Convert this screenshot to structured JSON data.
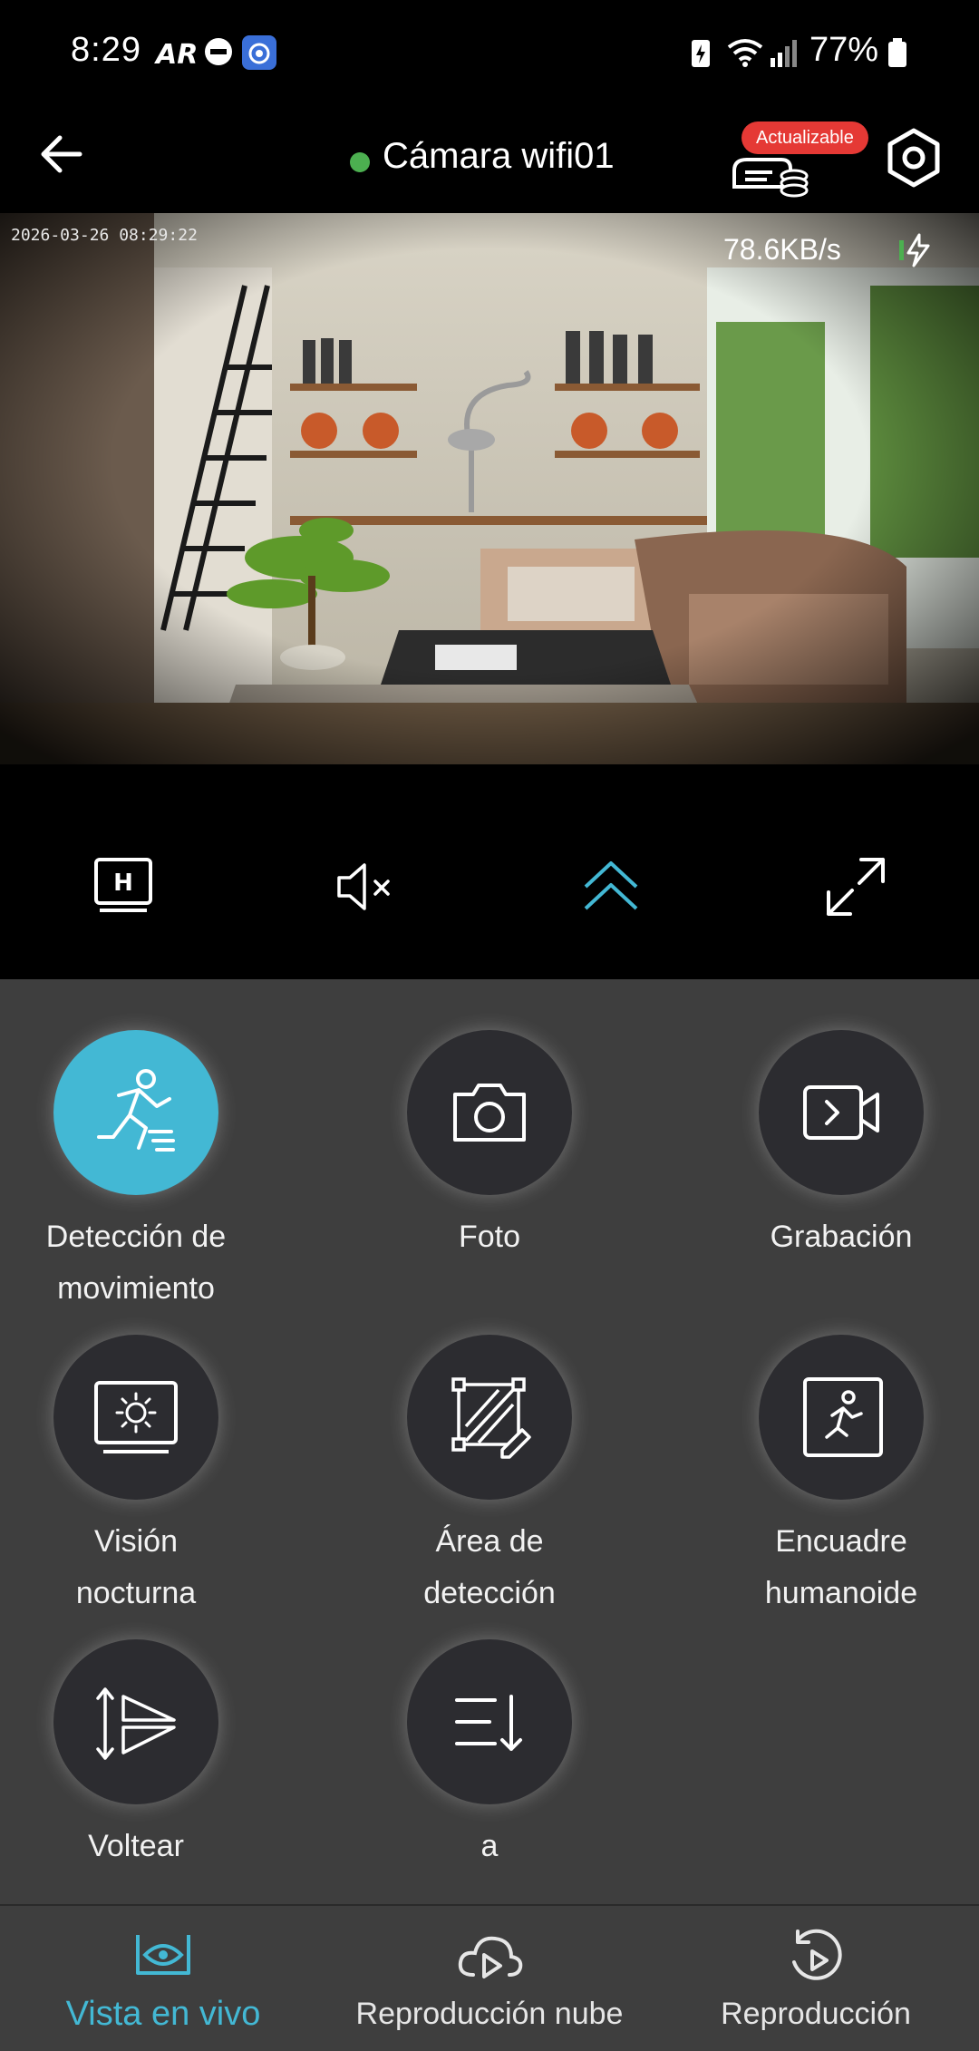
{
  "status_bar": {
    "time": "8:29",
    "battery": "77%"
  },
  "header": {
    "title": "Cámara wifi01",
    "update_badge": "Actualizable"
  },
  "video": {
    "timestamp": "2026-03-26 08:29:22",
    "bitrate": "78.6KB/s"
  },
  "controls": {
    "items": [
      "hd-quality-icon",
      "mute-icon",
      "collapse-up-icon",
      "fullscreen-icon"
    ]
  },
  "functions": [
    {
      "label_1": "Detección de",
      "label_2": "movimiento",
      "icon": "motion-detection-icon",
      "active": true
    },
    {
      "label_1": "Foto",
      "label_2": "",
      "icon": "camera-icon",
      "active": false
    },
    {
      "label_1": "Grabación",
      "label_2": "",
      "icon": "record-video-icon",
      "active": false
    },
    {
      "label_1": "Visión",
      "label_2": "nocturna",
      "icon": "night-vision-icon",
      "active": false
    },
    {
      "label_1": "Área de",
      "label_2": "detección",
      "icon": "detection-area-icon",
      "active": false
    },
    {
      "label_1": "Encuadre",
      "label_2": "humanoide",
      "icon": "humanoid-frame-icon",
      "active": false
    },
    {
      "label_1": "Voltear",
      "label_2": "",
      "icon": "flip-icon",
      "active": false
    },
    {
      "label_1": "a",
      "label_2": "",
      "icon": "sort-icon",
      "active": false
    }
  ],
  "bottom_nav": {
    "items": [
      {
        "label": "Vista en vivo",
        "icon": "live-view-eye-icon",
        "active": true
      },
      {
        "label": "Reproducción nube",
        "icon": "cloud-playback-icon",
        "active": false
      },
      {
        "label": "Reproducción",
        "icon": "playback-icon",
        "active": false
      }
    ]
  },
  "colors": {
    "accent": "#43b8d4",
    "online": "#4caf50",
    "badge": "#e53935",
    "panel": "#3e3e3e"
  }
}
